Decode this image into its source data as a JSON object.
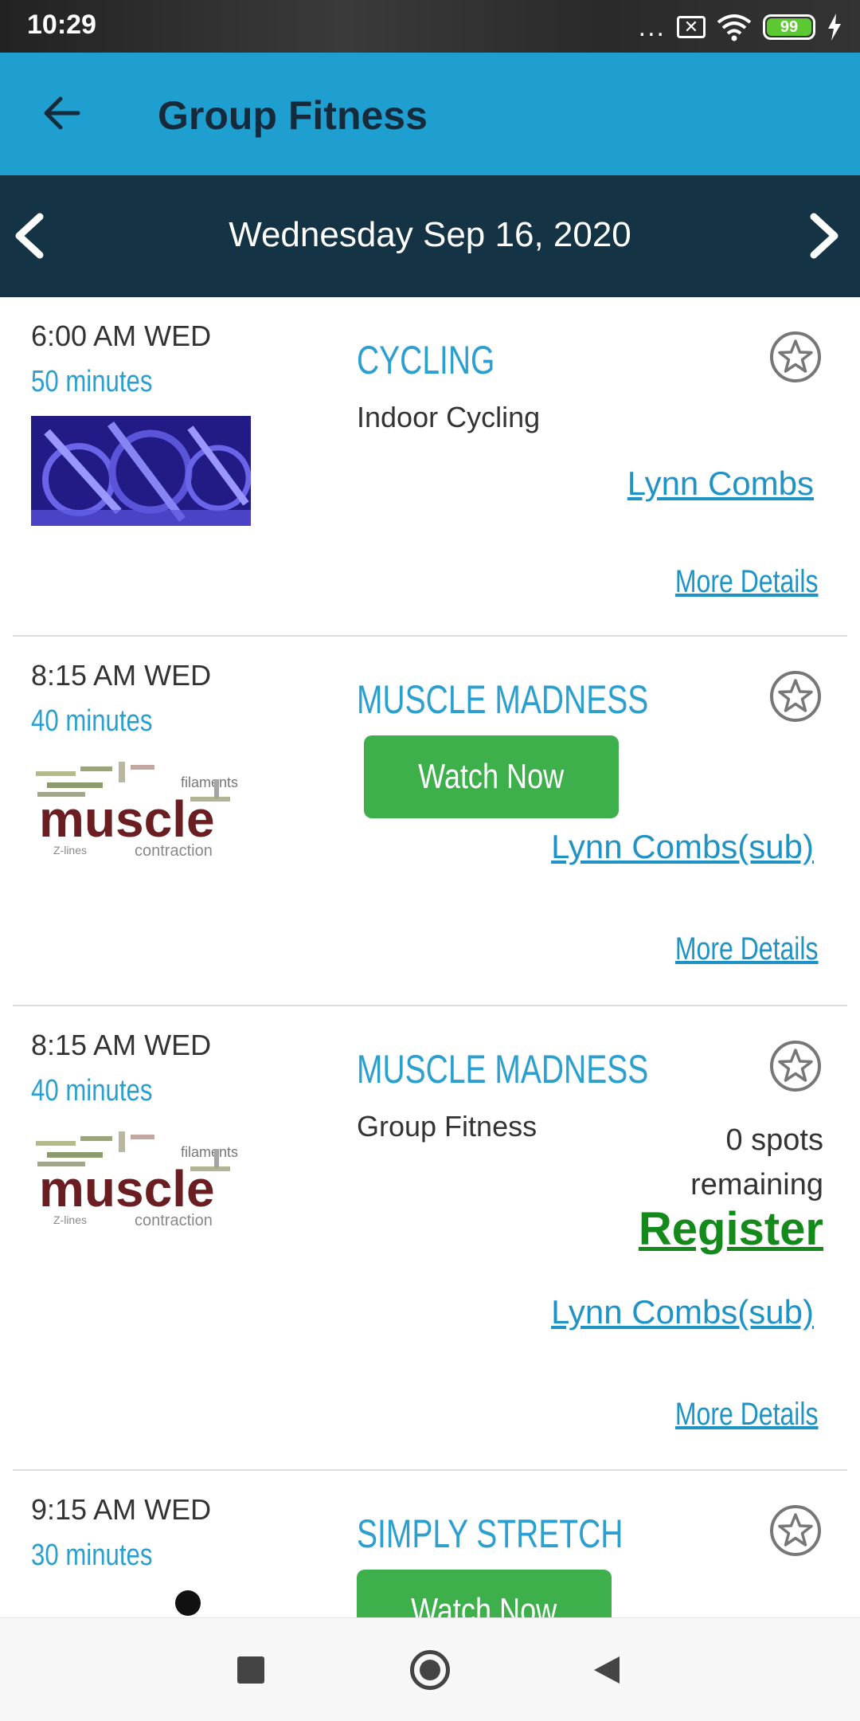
{
  "status_bar": {
    "time": "10:29",
    "dots": "...",
    "battery": "99"
  },
  "app_bar": {
    "title": "Group Fitness"
  },
  "date_bar": {
    "date": "Wednesday Sep 16, 2020"
  },
  "classes": [
    {
      "time": "6:00 AM WED",
      "duration": "50 minutes",
      "name": "CYCLING",
      "subtitle": "Indoor Cycling",
      "instructor": "Lynn Combs",
      "more": "More Details"
    },
    {
      "time": "8:15 AM WED",
      "duration": "40 minutes",
      "name": "MUSCLE MADNESS",
      "watch_label": "Watch Now",
      "instructor": "Lynn Combs(sub)",
      "more": "More Details"
    },
    {
      "time": "8:15 AM WED",
      "duration": "40 minutes",
      "name": "MUSCLE MADNESS",
      "subtitle": "Group Fitness",
      "spots_line1": "0 spots",
      "spots_line2": "remaining",
      "register_label": "Register",
      "instructor": "Lynn Combs(sub)",
      "more": "More Details"
    },
    {
      "time": "9:15 AM WED",
      "duration": "30 minutes",
      "name": "SIMPLY STRETCH",
      "watch_label": "Watch Now"
    }
  ],
  "thumb_text": {
    "muscle": "muscle",
    "contraction": "contraction",
    "filaments": "filaments",
    "zlines": "Z-lines"
  },
  "colors": {
    "app_bar": "#1f9fcf",
    "date_bar": "#143344",
    "accent_blue": "#2a9fd0",
    "watch_green": "#3db04b",
    "register_green": "#138a1a"
  },
  "icons": {
    "back": "arrow-left-icon",
    "prev": "chevron-left-icon",
    "next": "chevron-right-icon",
    "favorite": "star-outline-icon"
  }
}
